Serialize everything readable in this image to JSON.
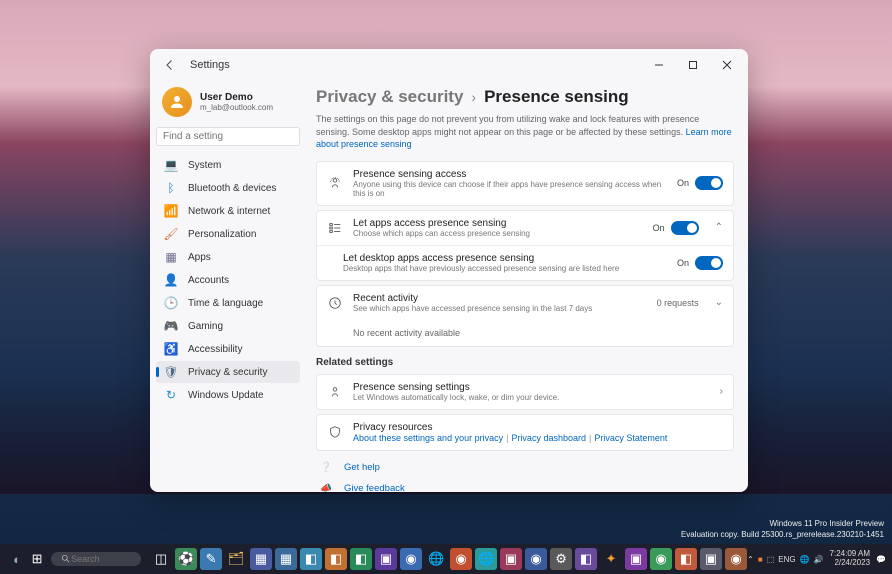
{
  "window": {
    "title": "Settings",
    "user": {
      "name": "User Demo",
      "email": "m_lab@outlook.com"
    },
    "search_placeholder": "Find a setting"
  },
  "nav": [
    {
      "label": "System",
      "icon": "💻",
      "color": "#5a7ba0"
    },
    {
      "label": "Bluetooth & devices",
      "icon": "ᛒ",
      "color": "#2080d0"
    },
    {
      "label": "Network & internet",
      "icon": "📶",
      "color": "#20b0c0"
    },
    {
      "label": "Personalization",
      "icon": "🖌",
      "color": "#d07040"
    },
    {
      "label": "Apps",
      "icon": "▦",
      "color": "#6a6a8a"
    },
    {
      "label": "Accounts",
      "icon": "👤",
      "color": "#5a8a9a"
    },
    {
      "label": "Time & language",
      "icon": "🕒",
      "color": "#5aa060"
    },
    {
      "label": "Gaming",
      "icon": "🎮",
      "color": "#6a6a6a"
    },
    {
      "label": "Accessibility",
      "icon": "♿",
      "color": "#3a8aa0"
    },
    {
      "label": "Privacy & security",
      "icon": "🛡",
      "color": "#4a6a8a"
    },
    {
      "label": "Windows Update",
      "icon": "↻",
      "color": "#2090d0"
    }
  ],
  "breadcrumb": {
    "parent": "Privacy & security",
    "current": "Presence sensing"
  },
  "intro": {
    "text": "The settings on this page do not prevent you from utilizing wake and lock features with presence sensing. Some desktop apps might not appear on this page or be affected by these settings.",
    "link": "Learn more about presence sensing"
  },
  "settings": {
    "access": {
      "title": "Presence sensing access",
      "desc": "Anyone using this device can choose if their apps have presence sensing access when this is on",
      "state": "On"
    },
    "apps": {
      "title": "Let apps access presence sensing",
      "desc": "Choose which apps can access presence sensing",
      "state": "On"
    },
    "desktop": {
      "title": "Let desktop apps access presence sensing",
      "desc": "Desktop apps that have previously accessed presence sensing are listed here",
      "state": "On"
    },
    "recent": {
      "title": "Recent activity",
      "desc": "See which apps have accessed presence sensing in the last 7 days",
      "count": "0 requests",
      "empty": "No recent activity available"
    }
  },
  "related": {
    "header": "Related settings",
    "sensing": {
      "title": "Presence sensing settings",
      "desc": "Let Windows automatically lock, wake, or dim your device."
    },
    "privacy": {
      "title": "Privacy resources",
      "links": [
        "About these settings and your privacy",
        "Privacy dashboard",
        "Privacy Statement"
      ]
    }
  },
  "help": {
    "get_help": "Get help",
    "feedback": "Give feedback"
  },
  "build": {
    "line1": "Windows 11 Pro Insider Preview",
    "line2": "Evaluation copy. Build 25300.rs_prerelease.230210-1451"
  },
  "taskbar": {
    "search_placeholder": "Search",
    "lang": "ENG",
    "time": "7:24:09 AM",
    "date": "2/24/2023"
  }
}
